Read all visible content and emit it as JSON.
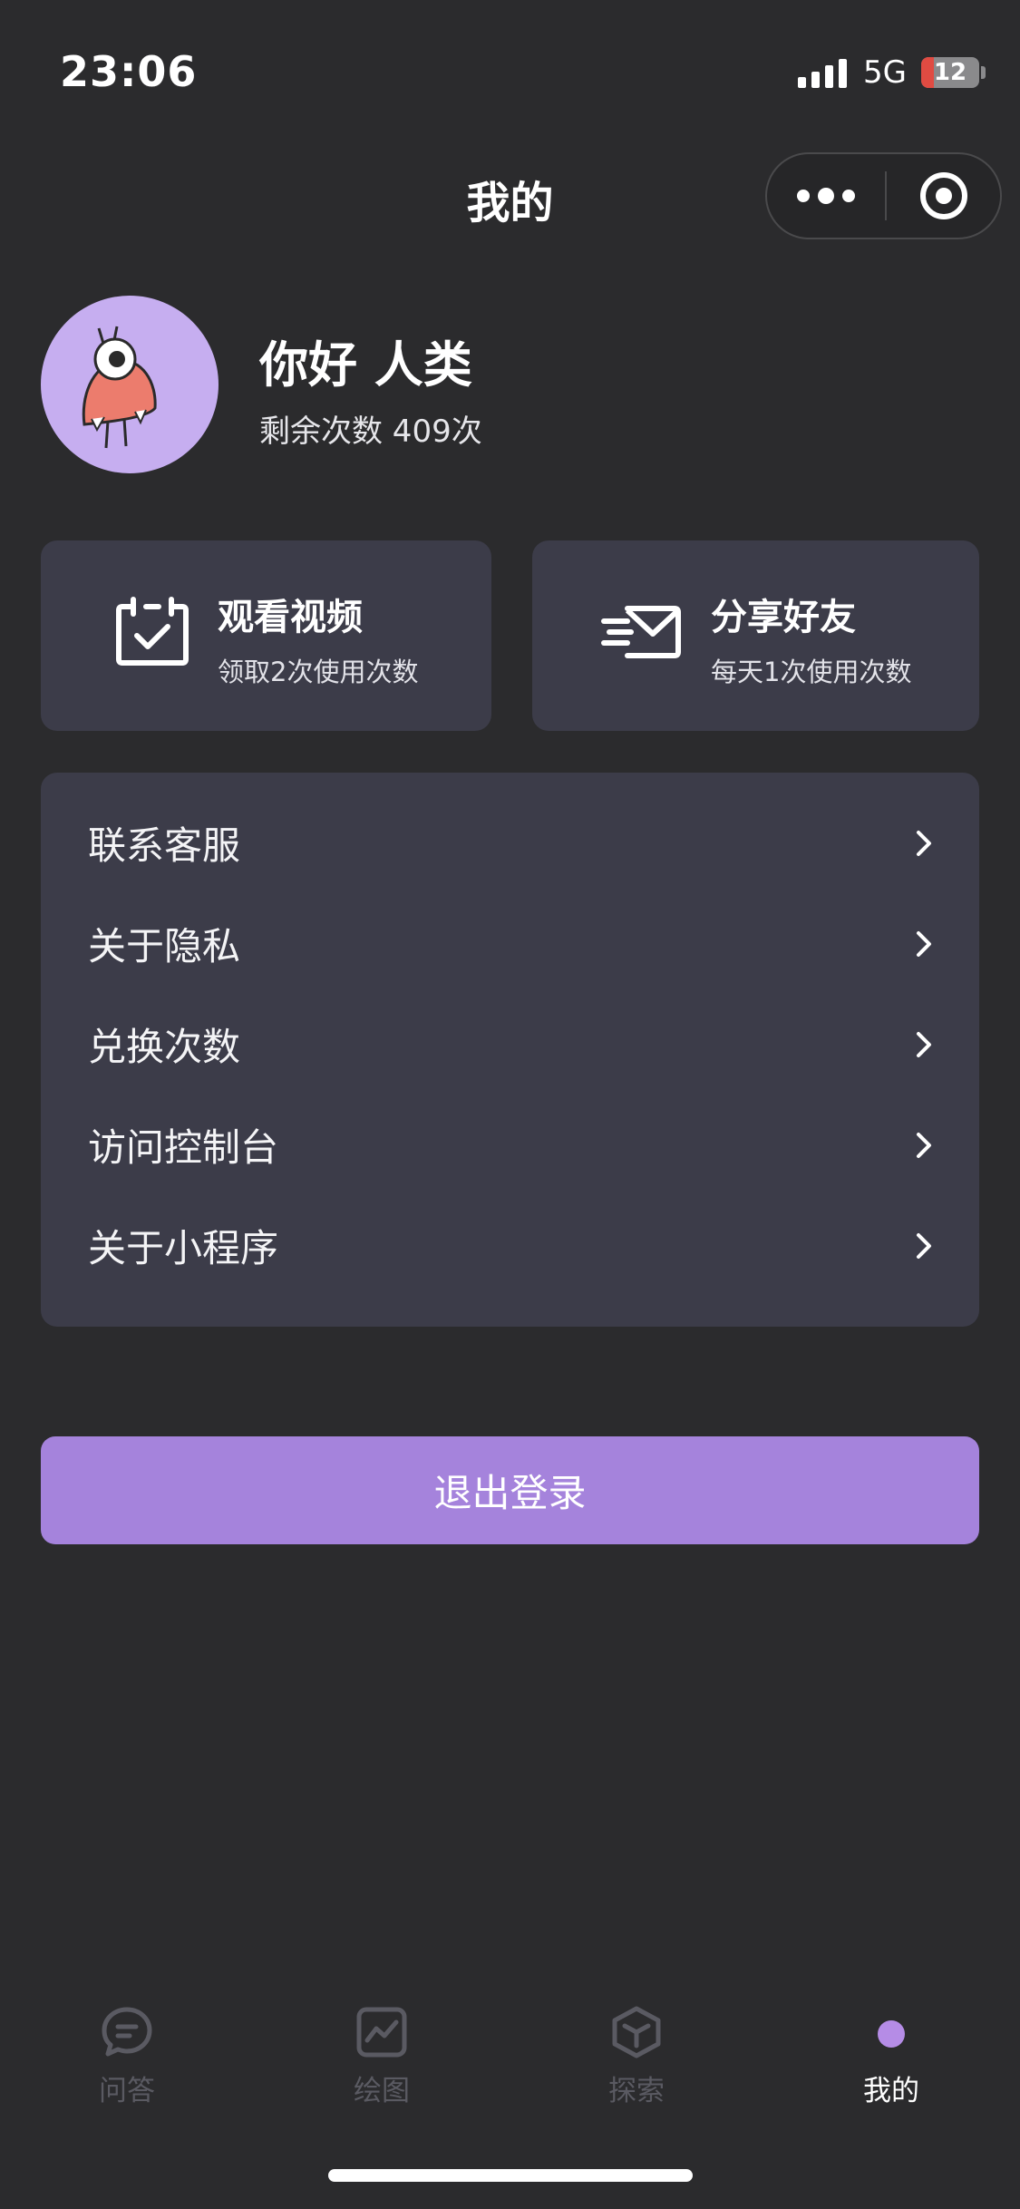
{
  "status_bar": {
    "time": "23:06",
    "network": "5G",
    "battery_level": "12"
  },
  "header": {
    "title": "我的"
  },
  "profile": {
    "greeting": "你好 人类",
    "remaining": "剩余次数 409次"
  },
  "cards": {
    "watch_video": {
      "title": "观看视频",
      "subtitle": "领取2次使用次数",
      "icon": "calendar-check-icon"
    },
    "share_friend": {
      "title": "分享好友",
      "subtitle": "每天1次使用次数",
      "icon": "envelope-send-icon"
    }
  },
  "menu": {
    "items": [
      {
        "label": "联系客服"
      },
      {
        "label": "关于隐私"
      },
      {
        "label": "兑换次数"
      },
      {
        "label": "访问控制台"
      },
      {
        "label": "关于小程序"
      }
    ]
  },
  "logout_label": "退出登录",
  "tabbar": {
    "tabs": [
      {
        "label": "问答",
        "icon": "chat-bubble-icon"
      },
      {
        "label": "绘图",
        "icon": "chart-frame-icon"
      },
      {
        "label": "探索",
        "icon": "cube-icon"
      },
      {
        "label": "我的",
        "icon": "dot-icon"
      }
    ],
    "active": "我的"
  },
  "colors": {
    "background": "#2b2b2d",
    "card": "#3c3c49",
    "accent": "#a583dc",
    "tab_dot": "#b58ce6",
    "inactive_tab": "#5a5a62"
  }
}
